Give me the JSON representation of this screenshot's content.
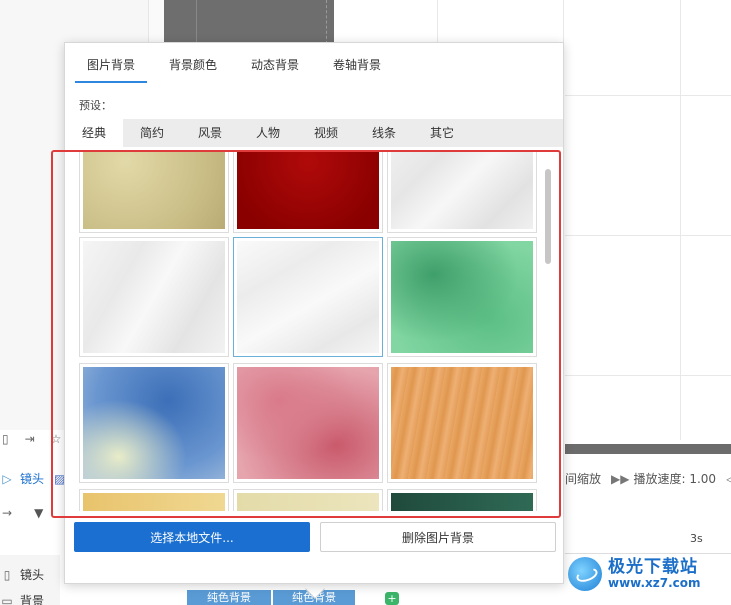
{
  "popup": {
    "main_tabs": [
      {
        "label": "图片背景",
        "active": true
      },
      {
        "label": "背景颜色",
        "active": false
      },
      {
        "label": "动态背景",
        "active": false
      },
      {
        "label": "卷轴背景",
        "active": false
      }
    ],
    "preset_label": "预设：",
    "sub_tabs": [
      {
        "label": "经典",
        "active": true
      },
      {
        "label": "简约",
        "active": false
      },
      {
        "label": "风景",
        "active": false
      },
      {
        "label": "人物",
        "active": false
      },
      {
        "label": "视频",
        "active": false
      },
      {
        "label": "线条",
        "active": false
      },
      {
        "label": "其它",
        "active": false
      }
    ],
    "thumbnails": [
      {
        "name": "beige-paper"
      },
      {
        "name": "dark-red"
      },
      {
        "name": "white-polygon"
      },
      {
        "name": "light-gray-polygon"
      },
      {
        "name": "white-polygon-selected"
      },
      {
        "name": "green-watercolor"
      },
      {
        "name": "blue-watercolor"
      },
      {
        "name": "pink-watercolor"
      },
      {
        "name": "wood-orange"
      },
      {
        "name": "yellow-partial"
      },
      {
        "name": "cream-partial"
      },
      {
        "name": "dark-green-partial"
      }
    ],
    "select_file_label": "选择本地文件...",
    "delete_bg_label": "删除图片背景"
  },
  "timeline": {
    "row_lens_label": "镜头",
    "row_lens2_label": "镜头",
    "row_bg_label": "背景",
    "zoom_label": "间缩放",
    "speed_label": "播放速度: 1.00",
    "time_label": "3s",
    "clips": [
      "纯色背景",
      "纯色背景"
    ]
  },
  "watermark": {
    "title": "极光下载站",
    "url": "www.xz7.com"
  },
  "colors": {
    "accent": "#1a6fd0",
    "highlight": "#e03b3b",
    "tab_underline": "#2e86de"
  }
}
